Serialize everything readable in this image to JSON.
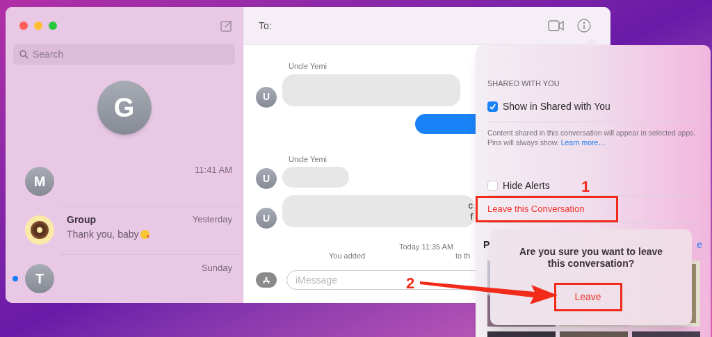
{
  "sidebar": {
    "search": {
      "placeholder": "Search"
    },
    "pinned": {
      "initial": "G"
    },
    "conversations": [
      {
        "kind": "letter",
        "initial": "M",
        "time": "11:41 AM",
        "unread": false
      },
      {
        "kind": "emoji",
        "name": "Group",
        "preview": "Thank you, baby",
        "time": "Yesterday",
        "unread": false
      },
      {
        "kind": "letter",
        "initial": "T",
        "time": "Sunday",
        "unread": true
      }
    ]
  },
  "chat": {
    "to_label": "To:",
    "messages": [
      {
        "kind": "incoming",
        "sender": "Uncle Yemi",
        "avatar": "U"
      },
      {
        "kind": "outgoing"
      },
      {
        "kind": "incoming",
        "sender": "Uncle Yemi",
        "avatar": "U"
      },
      {
        "kind": "incoming",
        "avatar": "U",
        "fragment_lines": [
          "c",
          "f"
        ]
      }
    ],
    "notice": {
      "time": "Today 11:35 AM",
      "left_text": "You added",
      "right_text": "to th"
    },
    "input": {
      "placeholder": "iMessage"
    }
  },
  "info_popover": {
    "section_title": "SHARED WITH YOU",
    "shared_option": {
      "label": "Show in Shared with You",
      "checked": true
    },
    "description": "Content shared in this conversation will appear in selected apps. Pins will always show.",
    "link": "Learn more…",
    "alerts_option": {
      "label": "Hide Alerts",
      "checked": false
    },
    "leave_action": "Leave this Conversation",
    "cut_left": "P",
    "cut_right": "e"
  },
  "confirm_popover": {
    "message": "Are you sure you want to leave this conversation?",
    "button": "Leave"
  },
  "annotations": [
    {
      "label": "1"
    },
    {
      "label": "2"
    }
  ]
}
